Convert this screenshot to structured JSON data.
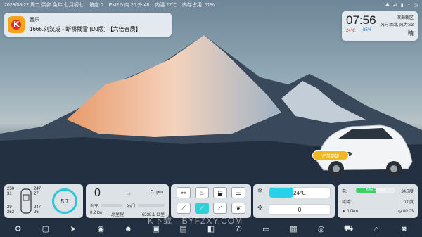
{
  "status": {
    "date": "2023/08/22 周二 癸卯 兔年 七月初七",
    "slope": "坡度:0",
    "pm": "PM2.5 内:20 外:48",
    "temp": "内温:27℃",
    "memory": "内存占用: 61%",
    "icons": [
      "bluetooth-icon",
      "usb-icon",
      "signal-icon",
      "wifi-icon",
      "clock-icon"
    ]
  },
  "music": {
    "app": "音乐",
    "song": "1666.刘汉成 - 断桥残雪 (DJ版) 【六倍音质】",
    "logo_letter": "K"
  },
  "clock": {
    "time": "07:56",
    "location": "滨海新区",
    "wind": "风向:西北 风力:≤3",
    "temperature": "24℃",
    "humidity": "85%",
    "weather": "晴"
  },
  "car": {
    "badge": "严禁倒卸"
  },
  "tires": {
    "fl": [
      "250",
      "31"
    ],
    "fr": [
      "247",
      "27"
    ],
    "rl": [
      "29",
      "252"
    ],
    "rr": [
      "247",
      "26"
    ],
    "center": "5.7"
  },
  "speed": {
    "value": "0",
    "rpm": "0 rpm",
    "brake_label": "刹车:",
    "throttle_label": "油门:",
    "power": "0.2 kw",
    "mileage_label": "总里程",
    "mileage": "6338.1 公里"
  },
  "controls": {
    "row1": [
      "seat-icon",
      "heat-icon",
      "door-icon",
      "menu-icon"
    ],
    "row2": [
      "wiper-icon",
      "seat-heat-icon",
      "seat-vent-icon",
      "leaf-icon"
    ],
    "row1_on": [
      false,
      false,
      false,
      false
    ],
    "row2_on": [
      false,
      true,
      false,
      false
    ]
  },
  "ac": {
    "temperature": "24℃",
    "fan": "0",
    "temp_fill": 0.4
  },
  "trip": {
    "label_elec": "电:",
    "range_bar": "50% 281km",
    "range_fill": 0.5,
    "extra": "34.7度",
    "consumption_label": "耗耗:",
    "consumption": "0.0度",
    "distance": "0.0km",
    "time": "00:03"
  },
  "dock": [
    "gear-icon",
    "square-icon",
    "nav-icon",
    "record-icon",
    "qq-icon",
    "camera-app-icon",
    "file-icon",
    "office-icon",
    "phone-icon",
    "screen-icon",
    "folder-icon",
    "dashcam-icon",
    "car-icon",
    "home-icon",
    "photo-icon"
  ],
  "watermark": "K下载 · BYFZXY.COM"
}
